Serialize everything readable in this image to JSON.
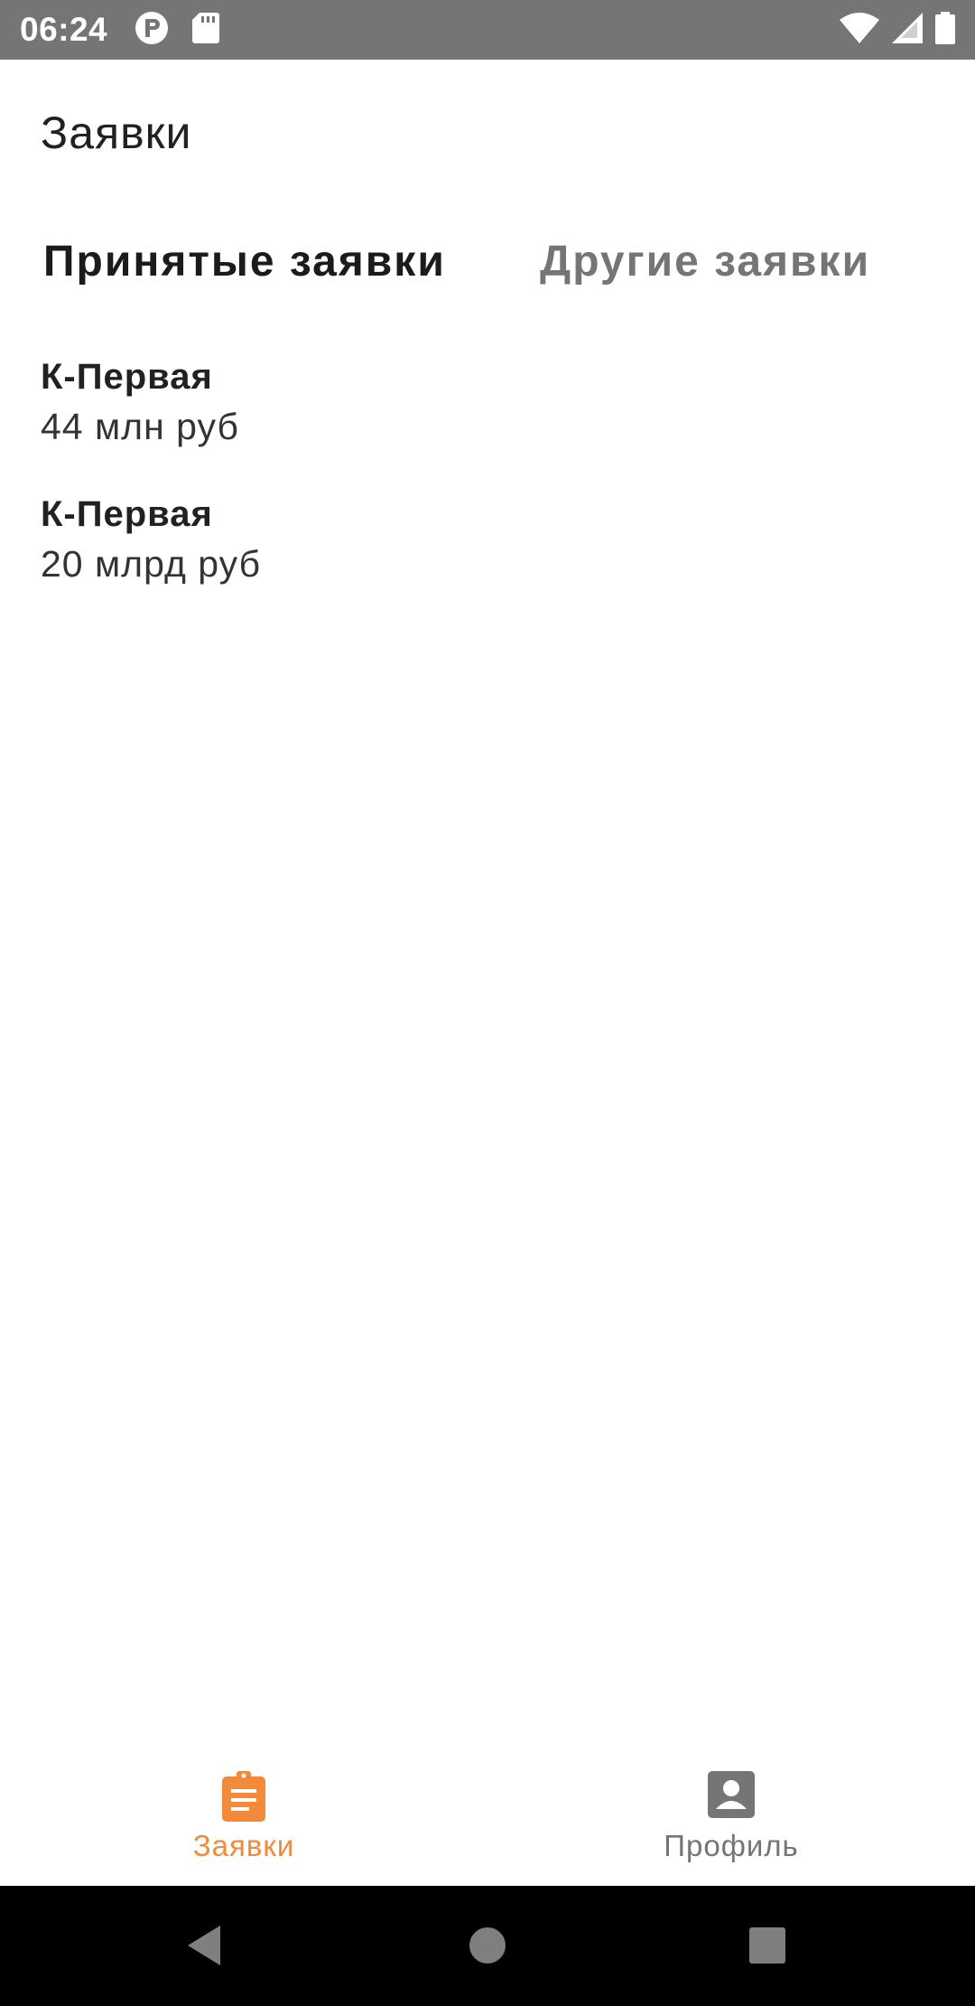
{
  "status_bar": {
    "time": "06:24",
    "left_icons": [
      "p-badge-icon",
      "sd-card-icon"
    ],
    "right_icons": [
      "wifi-icon",
      "signal-icon",
      "battery-icon"
    ]
  },
  "header": {
    "title": "Заявки"
  },
  "tabs": [
    {
      "label": "Принятые заявки",
      "selected": true
    },
    {
      "label": "Другие заявки",
      "selected": false
    }
  ],
  "list": [
    {
      "title": "К-Первая",
      "amount": "44 млн руб"
    },
    {
      "title": "К-Первая",
      "amount": "20 млрд руб"
    }
  ],
  "bottom_nav": [
    {
      "label": "Заявки",
      "icon": "clipboard-list-icon",
      "active": true
    },
    {
      "label": "Профиль",
      "icon": "account-box-icon",
      "active": false
    }
  ],
  "colors": {
    "accent": "#f38a3a",
    "status_bar": "#757575",
    "inactive": "#757575",
    "text_primary": "#212121"
  }
}
